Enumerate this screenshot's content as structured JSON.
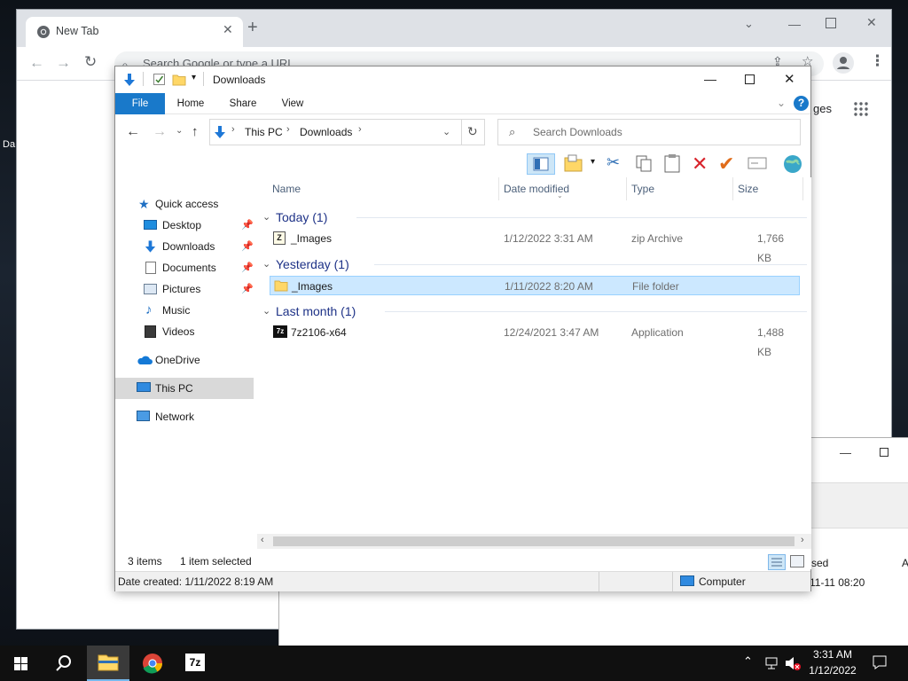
{
  "desktop": {
    "label_fragment": "Da"
  },
  "chrome": {
    "tab_title": "New Tab",
    "omnibox_placeholder": "Search Google or type a URL",
    "images_link_fragment": "ges"
  },
  "bg_window": {
    "col_fragment": "sed",
    "col_fragment2": "A",
    "date_fragment": "11-11 08:20"
  },
  "explorer": {
    "title": "Downloads",
    "ribbon_tabs": [
      "File",
      "Home",
      "Share",
      "View"
    ],
    "breadcrumb": [
      "This PC",
      "Downloads"
    ],
    "search_placeholder": "Search Downloads",
    "nav": {
      "quick_access": "Quick access",
      "desktop": "Desktop",
      "downloads": "Downloads",
      "documents": "Documents",
      "pictures": "Pictures",
      "music": "Music",
      "videos": "Videos",
      "onedrive": "OneDrive",
      "this_pc": "This PC",
      "network": "Network"
    },
    "columns": {
      "name": "Name",
      "date": "Date modified",
      "type": "Type",
      "size": "Size"
    },
    "groups": [
      {
        "label": "Today (1)",
        "files": [
          {
            "name": "_Images",
            "date": "1/12/2022 3:31 AM",
            "type": "zip Archive",
            "size": "1,766 KB"
          }
        ]
      },
      {
        "label": "Yesterday (1)",
        "files": [
          {
            "name": "_Images",
            "date": "1/11/2022 8:20 AM",
            "type": "File folder",
            "size": ""
          }
        ]
      },
      {
        "label": "Last month (1)",
        "files": [
          {
            "name": "7z2106-x64",
            "date": "12/24/2021 3:47 AM",
            "type": "Application",
            "size": "1,488 KB"
          }
        ]
      }
    ],
    "status": {
      "items": "3 items",
      "selected": "1 item selected"
    },
    "details": {
      "date_created": "Date created: 1/11/2022 8:19 AM",
      "location": "Computer"
    }
  },
  "taskbar": {
    "time": "3:31 AM",
    "date": "1/12/2022",
    "sevenzip_label": "7z"
  },
  "colors": {
    "accent": "#1979ca",
    "selection": "#cce8ff",
    "group_text": "#1e3287"
  }
}
